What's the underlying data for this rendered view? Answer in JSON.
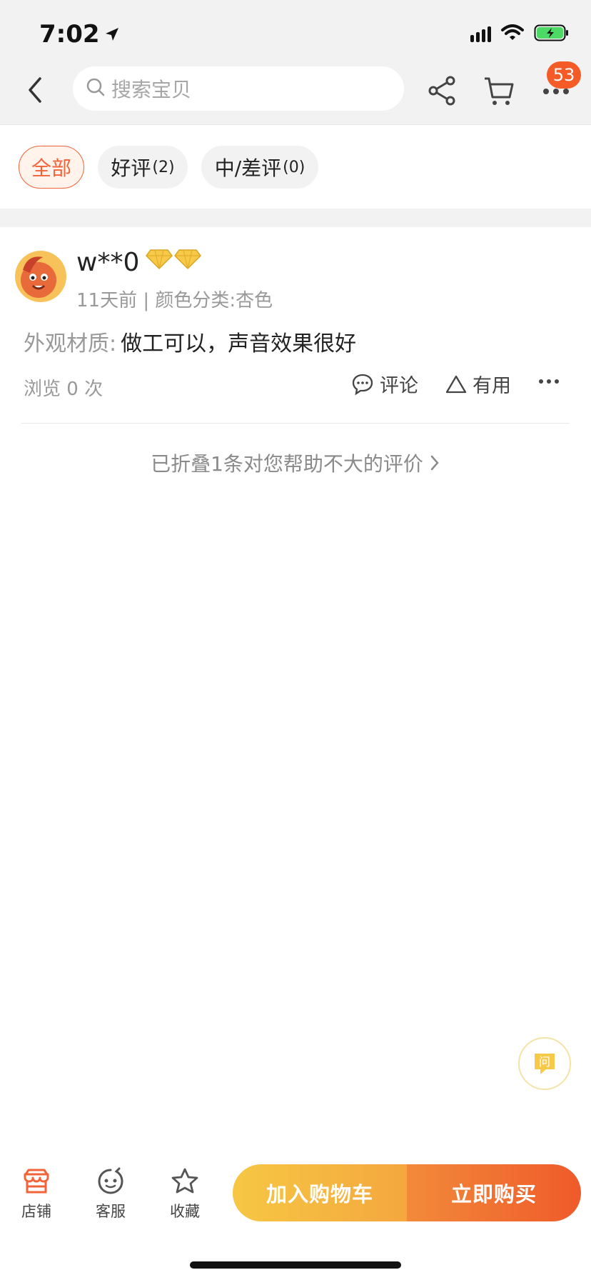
{
  "status_bar": {
    "time": "7:02"
  },
  "header": {
    "search_placeholder": "搜索宝贝",
    "badge_count": "53"
  },
  "filters": [
    {
      "label": "全部",
      "count": "",
      "active": true
    },
    {
      "label": "好评",
      "count": "(2)",
      "active": false
    },
    {
      "label": "中/差评",
      "count": "(0)",
      "active": false
    }
  ],
  "review": {
    "username": "w**0",
    "meta": "11天前 | 颜色分类:杏色",
    "content_label": "外观材质:",
    "content_text": "做工可以，声音效果很好",
    "views": "浏览 0 次",
    "comment_label": "评论",
    "useful_label": "有用"
  },
  "folded_notice": "已折叠1条对您帮助不大的评价",
  "ask_label": "问",
  "bottom_bar": {
    "store_label": "店铺",
    "service_label": "客服",
    "favorite_label": "收藏",
    "add_to_cart_label": "加入购物车",
    "buy_now_label": "立即购买"
  },
  "colors": {
    "accent": "#f1643a",
    "badge": "#f45b27",
    "cart_gradient": [
      "#f6c744",
      "#f4a73e"
    ],
    "buy_gradient": [
      "#f28a3a",
      "#ef5a2a"
    ]
  }
}
